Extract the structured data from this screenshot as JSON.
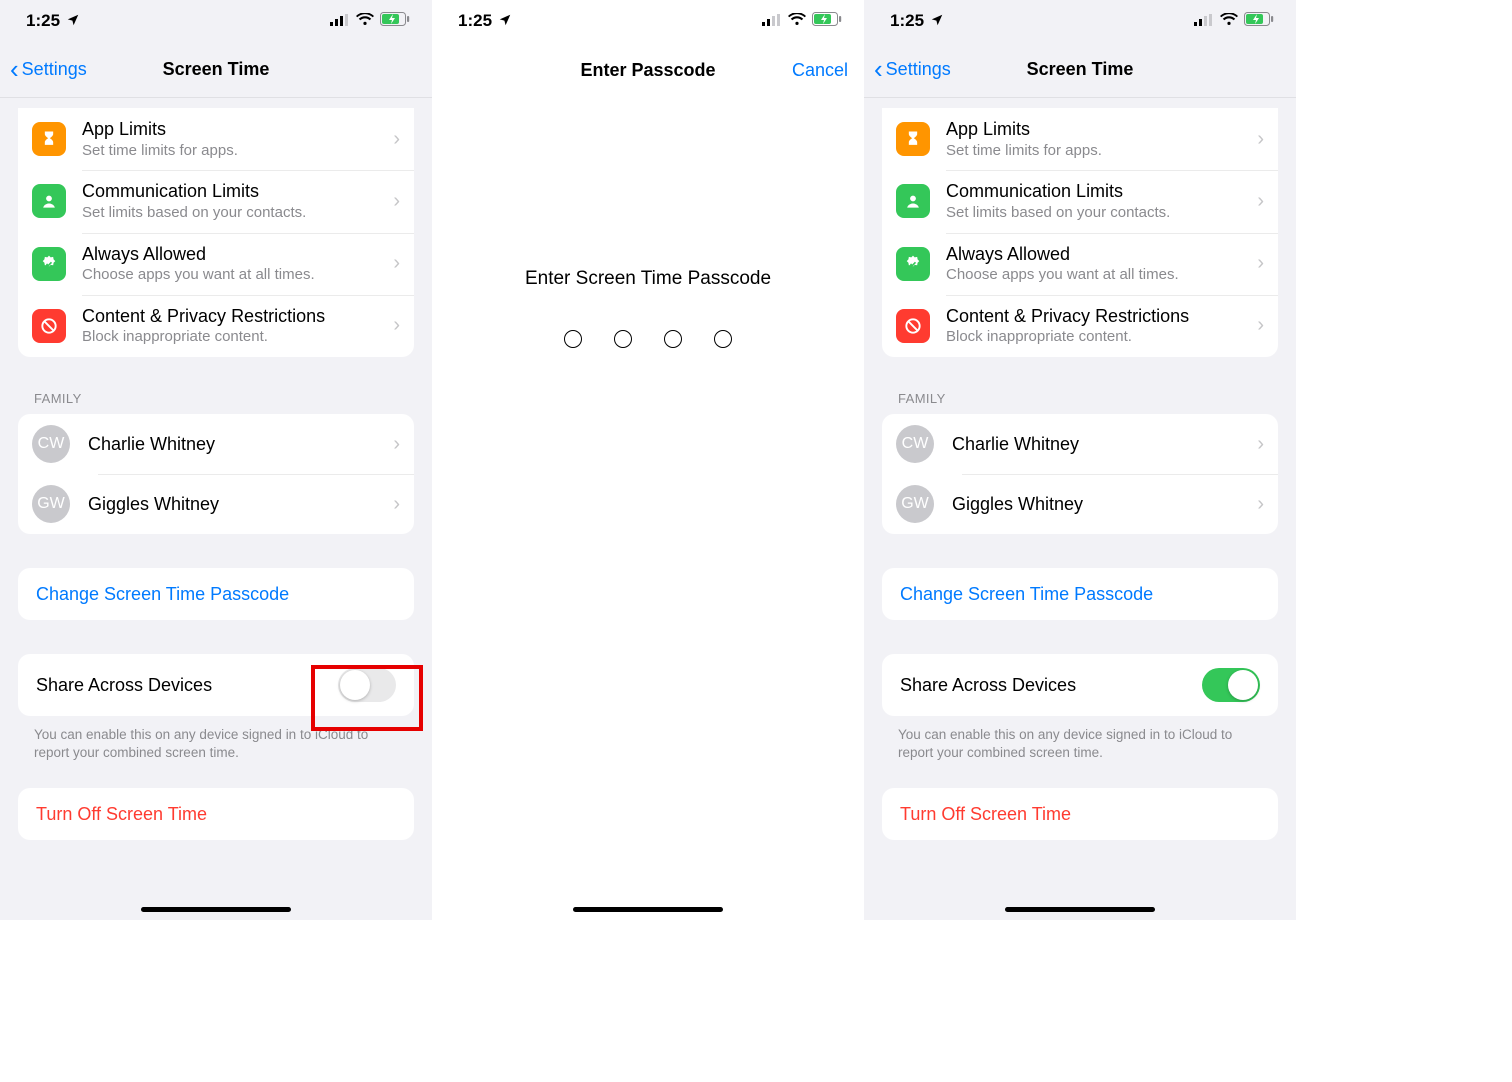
{
  "status": {
    "time": "1:25"
  },
  "screen1": {
    "back": "Settings",
    "title": "Screen Time",
    "items": [
      {
        "title": "App Limits",
        "sub": "Set time limits for apps."
      },
      {
        "title": "Communication Limits",
        "sub": "Set limits based on your contacts."
      },
      {
        "title": "Always Allowed",
        "sub": "Choose apps you want at all times."
      },
      {
        "title": "Content & Privacy Restrictions",
        "sub": "Block inappropriate content."
      }
    ],
    "family_header": "FAMILY",
    "family": [
      {
        "initials": "CW",
        "name": "Charlie Whitney"
      },
      {
        "initials": "GW",
        "name": "Giggles Whitney"
      }
    ],
    "change_passcode": "Change Screen Time Passcode",
    "share_label": "Share Across Devices",
    "share_footer": "You can enable this on any device signed in to iCloud to report your combined screen time.",
    "turn_off": "Turn Off Screen Time",
    "share_on": false
  },
  "screen2": {
    "title": "Enter Passcode",
    "cancel": "Cancel",
    "prompt": "Enter Screen Time Passcode"
  },
  "screen3": {
    "back": "Settings",
    "title": "Screen Time",
    "share_on": true
  },
  "colors": {
    "orange": "#ff9500",
    "green": "#34c759",
    "green2": "#32cd5a",
    "red": "#ff3b30"
  }
}
